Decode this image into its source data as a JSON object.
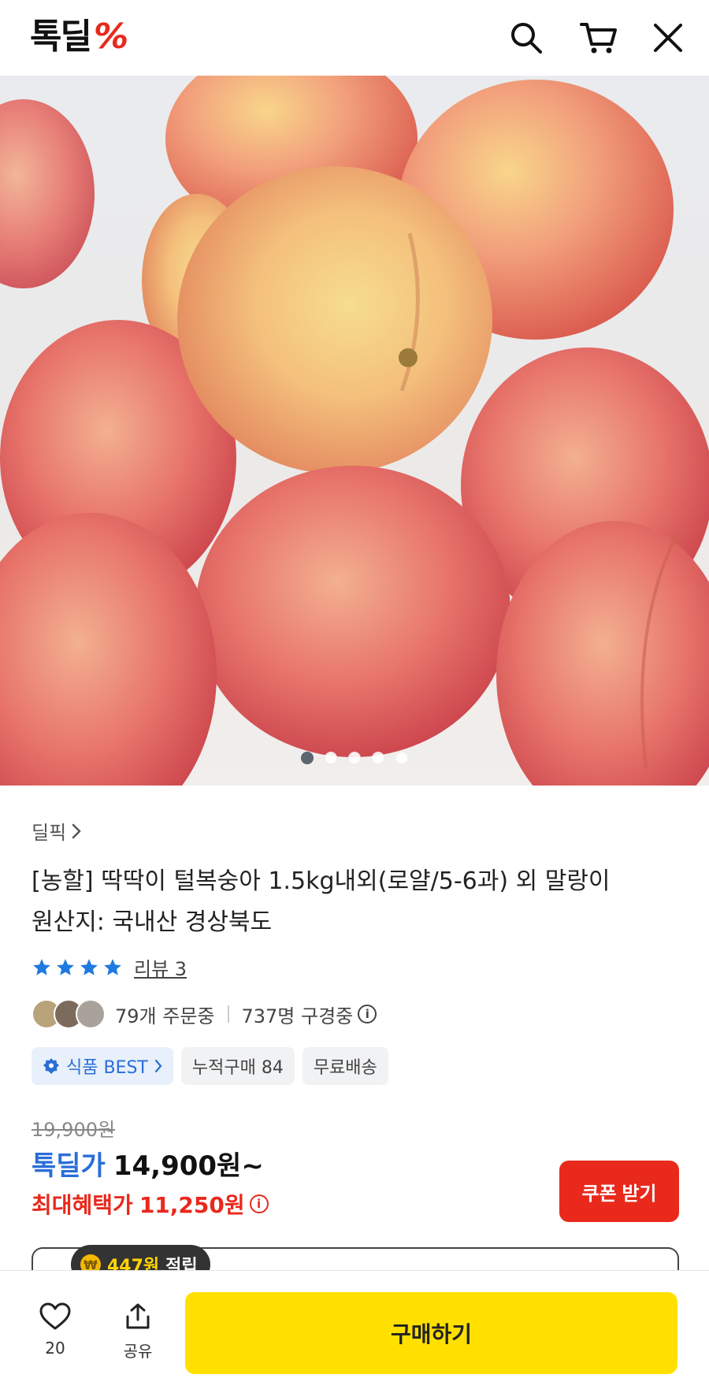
{
  "header": {
    "logo_text": "톡딜",
    "logo_mark": "%",
    "icons": [
      "search-icon",
      "cart-icon",
      "close-icon"
    ]
  },
  "gallery": {
    "image_count": 5,
    "active_index": 0
  },
  "product": {
    "category": "딜픽",
    "title_line1": "[농할] 딱딱이 털복숭아 1.5kg내외(로얄/5-6과) 외 말랑이",
    "title_line2": "원산지: 국내산 경상북도",
    "rating_stars": 4,
    "review_label": "리뷰 3",
    "orders_text": "79개 주문중",
    "viewers_text": "737명 구경중",
    "tags": {
      "best": "식품 BEST",
      "cumulative": "누적구매 84",
      "shipping": "무료배송"
    }
  },
  "price": {
    "original": "19,900원",
    "deal_label": "톡딜가",
    "deal_price": "14,900원~",
    "max_label": "최대혜택가",
    "max_price": "11,250원",
    "coupon_button": "쿠폰 받기"
  },
  "reward": {
    "amount": "447원",
    "suffix": "적립"
  },
  "bottom_bar": {
    "like_count": "20",
    "share_label": "공유",
    "buy_button": "구매하기"
  },
  "colors": {
    "brand_red": "#e8291c",
    "brand_blue": "#2a6ed8",
    "buy_yellow": "#ffe000"
  }
}
